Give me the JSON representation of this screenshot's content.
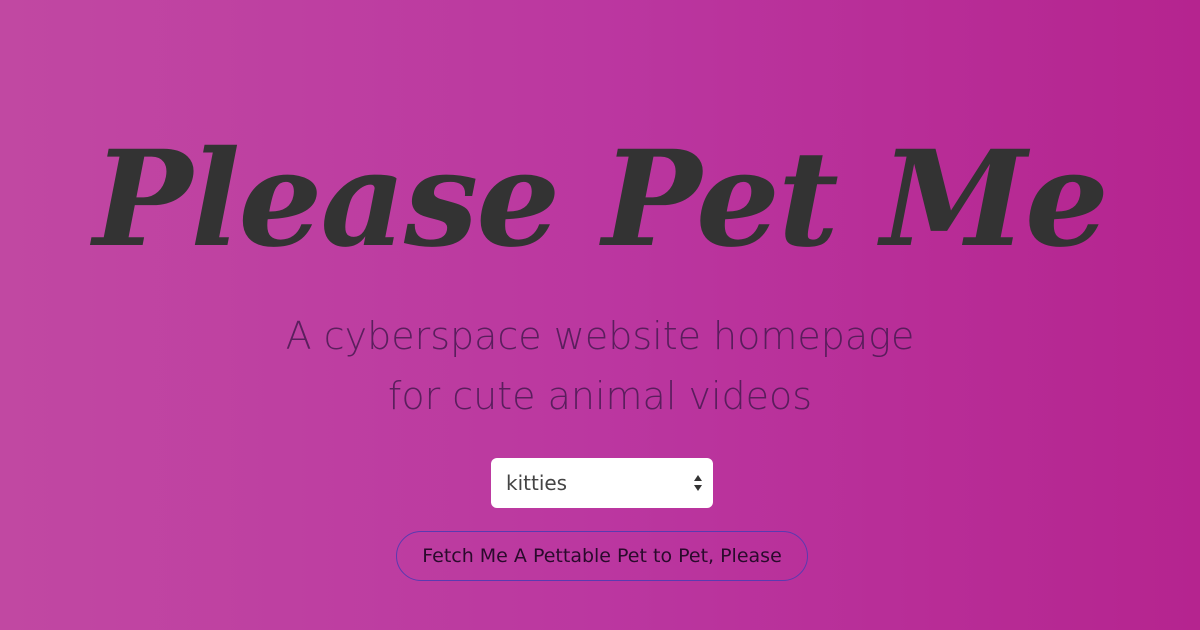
{
  "hero": {
    "title": "Please Pet Me",
    "tagline_line1": "A cyberspace website homepage",
    "tagline_line2": "for cute animal videos"
  },
  "pet_select": {
    "selected_value": "kitties",
    "icon": "select-arrows-icon"
  },
  "fetch_button": {
    "label": "Fetch Me A Pettable Pet to Pet, Please"
  },
  "colors": {
    "background_start": "#c148a2",
    "background_end": "#b5248f",
    "title": "#333333",
    "button_border": "#5a3ab0"
  }
}
